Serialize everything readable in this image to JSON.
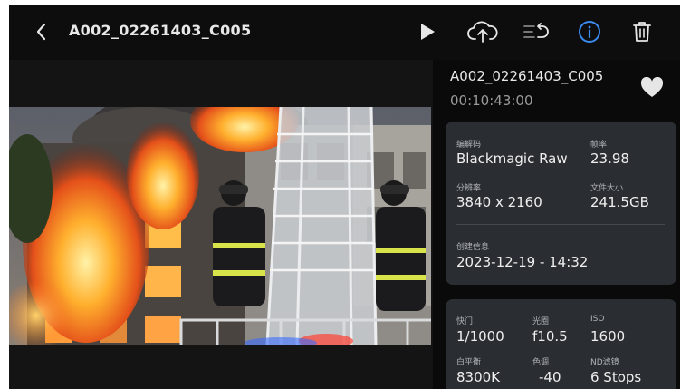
{
  "header": {
    "back_icon": "chevron-left-icon",
    "clip_title": "A002_02261403_C005",
    "actions": [
      {
        "name": "play",
        "icon": "play-icon"
      },
      {
        "name": "upload",
        "icon": "cloud-upload-icon"
      },
      {
        "name": "undo-list",
        "icon": "list-undo-icon"
      },
      {
        "name": "info",
        "icon": "info-icon",
        "active": true
      },
      {
        "name": "delete",
        "icon": "trash-icon"
      }
    ],
    "accent_color": "#3b8bef"
  },
  "preview": {
    "image": "firefighters-on-ladder-burning-building-photo"
  },
  "info": {
    "clip_name": "A002_02261403_C005",
    "timecode": "00:10:43:00",
    "favorite_icon": "heart-icon",
    "card1": {
      "codec_label": "编解码",
      "codec_value": "Blackmagic Raw",
      "fps_label": "帧率",
      "fps_value": "23.98",
      "resolution_label": "分辨率",
      "resolution_value": "3840 x 2160",
      "filesize_label": "文件大小",
      "filesize_value": "241.5GB",
      "created_label": "创建信息",
      "created_value": "2023-12-19 - 14:32"
    },
    "card2": {
      "shutter_label": "快门",
      "shutter_value": "1/1000",
      "aperture_label": "光圈",
      "aperture_value": "f10.5",
      "iso_label": "ISO",
      "iso_value": "1600",
      "wb_label": "白平衡",
      "wb_value": "8300K",
      "tint_label": "色调",
      "tint_value": "-40",
      "nd_label": "ND滤镜",
      "nd_value": "6 Stops"
    }
  }
}
